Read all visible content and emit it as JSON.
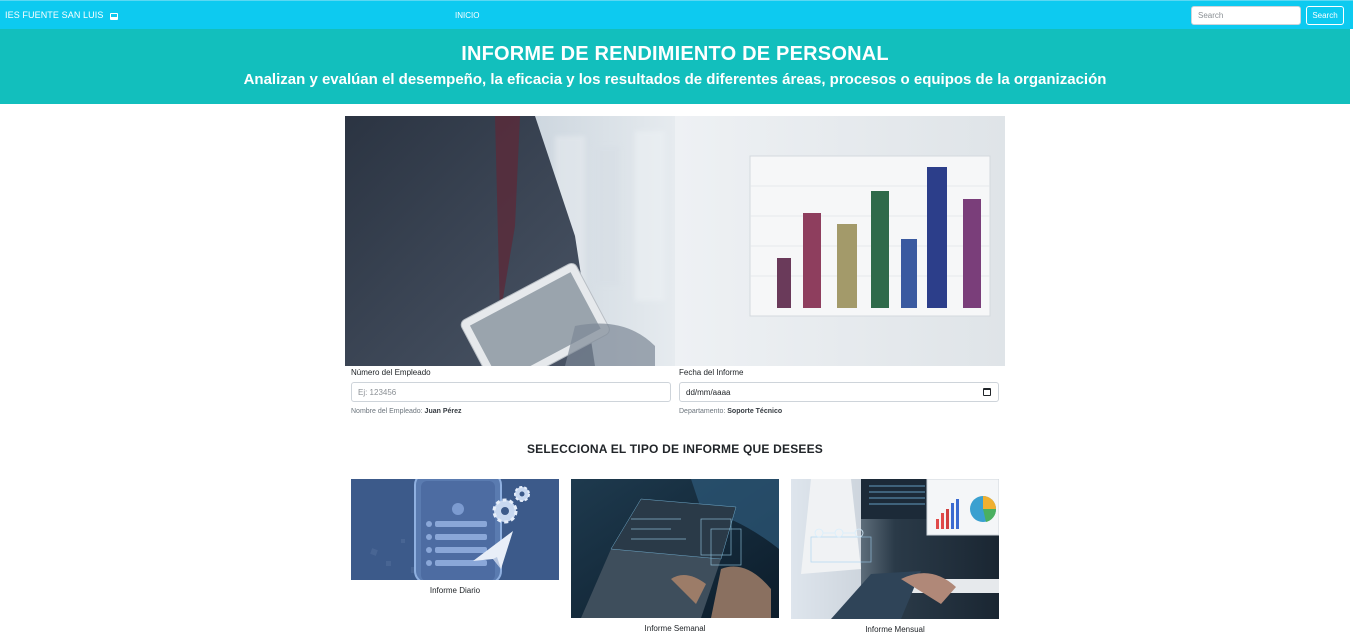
{
  "navbar": {
    "brand": "IES FUENTE SAN LUIS",
    "brand_icon": "monitor-icon",
    "nav_link": "INICIO",
    "search_placeholder": "Search",
    "search_button": "Search"
  },
  "header": {
    "title": "INFORME DE RENDIMIENTO DE PERSONAL",
    "subtitle": "Analizan y evalúan el desempeño, la eficacia y los resultados de diferentes áreas, procesos o equipos de la organización"
  },
  "form": {
    "employee_number_label": "Número del Empleado",
    "employee_number_placeholder": "Ej: 123456",
    "employee_name_label": "Nombre del Empleado:",
    "employee_name_value": "Juan Pérez",
    "report_date_label": "Fecha del Informe",
    "report_date_placeholder": "dd/mm/aaaa",
    "department_label": "Departamento:",
    "department_value": "Soporte Técnico"
  },
  "section": {
    "title": "SELECCIONA EL TIPO DE INFORME QUE DESEES"
  },
  "cards": [
    {
      "label": "Informe Diario"
    },
    {
      "label": "Informe Semanal"
    },
    {
      "label": "Informe Mensual"
    }
  ],
  "colors": {
    "navbar": "#0dcaf0",
    "header": "#12bfbd",
    "card1_bg": "#3c5a8a"
  }
}
